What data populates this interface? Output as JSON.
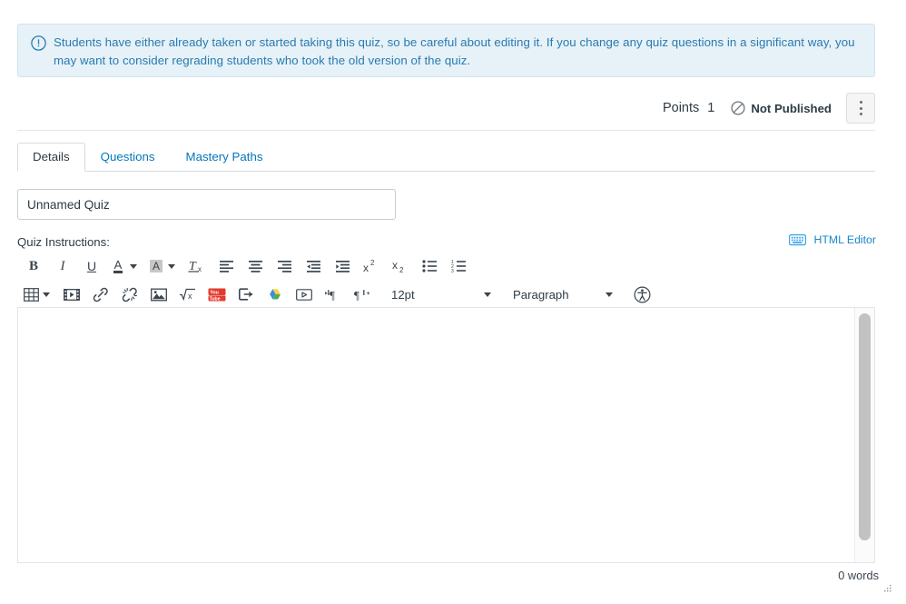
{
  "alert": {
    "icon": "info-circle-icon",
    "text": "Students have either already taken or started taking this quiz, so be careful about editing it. If you change any quiz questions in a significant way, you may want to consider regrading students who took the old version of the quiz.",
    "background_color": "#e6f2f8",
    "text_color": "#2a7ab0"
  },
  "meta": {
    "points_label": "Points",
    "points_value": "1",
    "publish_status": "Not Published",
    "publish_icon": "circle-slash-icon",
    "kebab_label": "more-options"
  },
  "tabs": [
    {
      "label": "Details",
      "active": true
    },
    {
      "label": "Questions",
      "active": false
    },
    {
      "label": "Mastery Paths",
      "active": false
    }
  ],
  "title_field": {
    "value": "Unnamed Quiz",
    "placeholder": "Quiz title"
  },
  "instructions": {
    "label": "Quiz Instructions:",
    "html_editor_link": "HTML Editor",
    "html_editor_icon": "keyboard-icon",
    "link_color": "#1b87cb"
  },
  "toolbar": {
    "row1": [
      {
        "name": "bold-button",
        "glyph": "B"
      },
      {
        "name": "italic-button",
        "glyph": "I"
      },
      {
        "name": "underline-button",
        "glyph": "U"
      },
      {
        "name": "text-color-button",
        "glyph": "A"
      },
      {
        "name": "text-color-dropdown",
        "glyph": ""
      },
      {
        "name": "highlight-color-button",
        "glyph": "A"
      },
      {
        "name": "highlight-color-dropdown",
        "glyph": ""
      },
      {
        "name": "clear-formatting-button",
        "glyph": "Tx"
      },
      {
        "name": "align-left-button",
        "glyph": ""
      },
      {
        "name": "align-center-button",
        "glyph": ""
      },
      {
        "name": "align-right-button",
        "glyph": ""
      },
      {
        "name": "outdent-button",
        "glyph": ""
      },
      {
        "name": "indent-button",
        "glyph": ""
      },
      {
        "name": "superscript-button",
        "glyph": "x2"
      },
      {
        "name": "subscript-button",
        "glyph": "x2"
      },
      {
        "name": "bulleted-list-button",
        "glyph": ""
      },
      {
        "name": "numbered-list-button",
        "glyph": ""
      }
    ],
    "row2": [
      {
        "name": "table-button",
        "glyph": ""
      },
      {
        "name": "table-dropdown",
        "glyph": ""
      },
      {
        "name": "media-button",
        "glyph": ""
      },
      {
        "name": "link-button",
        "glyph": ""
      },
      {
        "name": "unlink-button",
        "glyph": ""
      },
      {
        "name": "image-button",
        "glyph": ""
      },
      {
        "name": "math-equation-button",
        "glyph": ""
      },
      {
        "name": "youtube-button",
        "glyph": ""
      },
      {
        "name": "external-tool-button",
        "glyph": ""
      },
      {
        "name": "google-drive-button",
        "glyph": ""
      },
      {
        "name": "embed-video-button",
        "glyph": ""
      },
      {
        "name": "ltr-direction-button",
        "glyph": ""
      },
      {
        "name": "rtl-direction-button",
        "glyph": ""
      }
    ],
    "font_size": "12pt",
    "block_format": "Paragraph",
    "accessibility_checker": "accessibility-icon"
  },
  "editor_body": {
    "content": "",
    "word_count": "0 words"
  }
}
